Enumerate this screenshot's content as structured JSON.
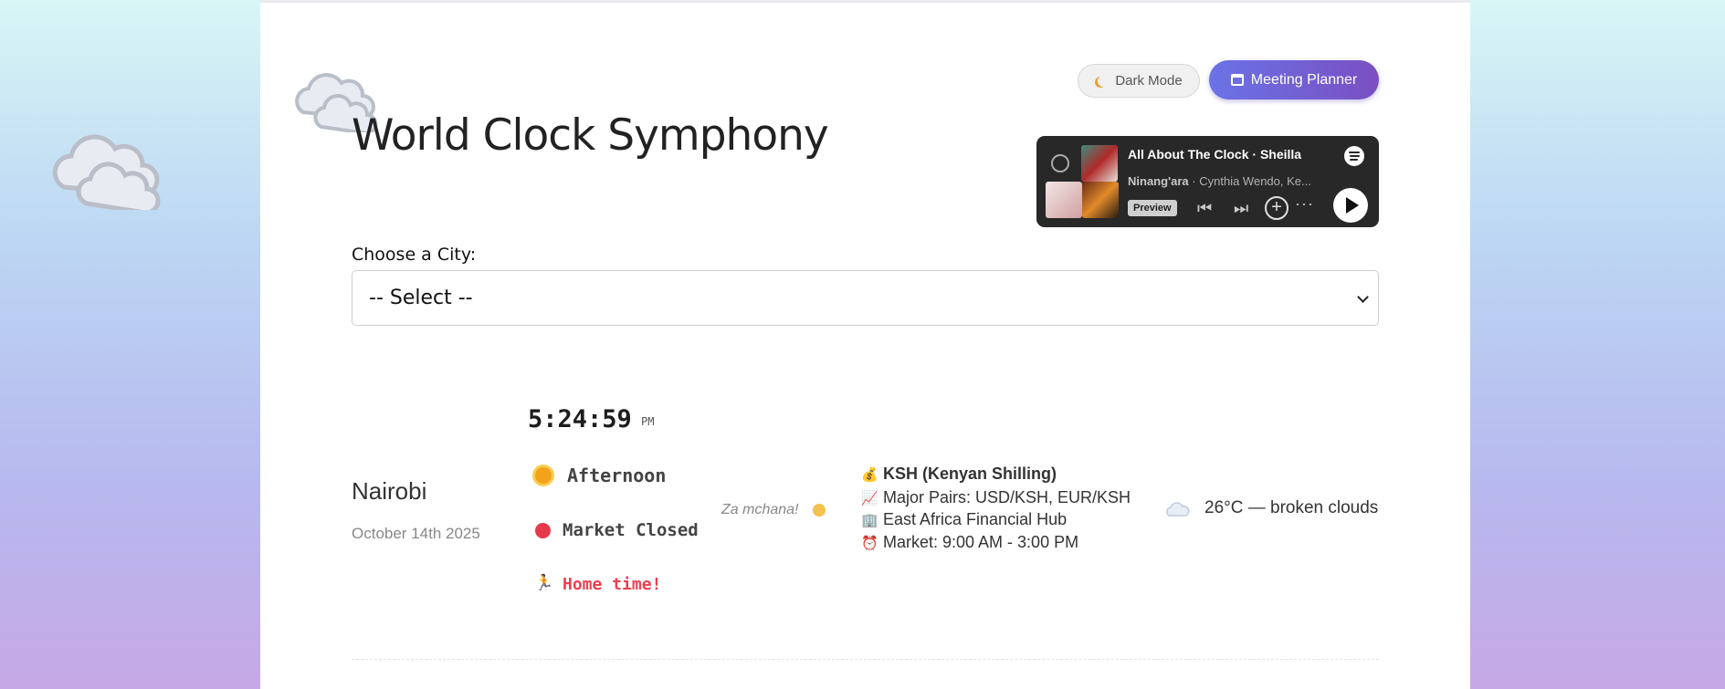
{
  "app": {
    "title": "World Clock Symphony"
  },
  "buttons": {
    "dark_mode": "Dark Mode",
    "meeting_planner": "Meeting Planner"
  },
  "player": {
    "track": "All About The Clock",
    "artist": "Sheilla",
    "album": "Ninang'ara",
    "album_artist": "Cynthia Wendo, Ke...",
    "preview_label": "Preview"
  },
  "city_select": {
    "label": "Choose a City:",
    "selected": "-- Select --"
  },
  "city": {
    "name": "Nairobi",
    "date": "October 14th 2025",
    "time": "5:24:59",
    "ampm": "PM",
    "period": "Afternoon",
    "market_status": "Market Closed",
    "status_message": "Home time!",
    "greeting": "Za mchana!",
    "currency": "KSH (Kenyan Shilling)",
    "major_pairs": "Major Pairs: USD/KSH, EUR/KSH",
    "hub": "East Africa Financial Hub",
    "market_hours": "Market: 9:00 AM - 3:00 PM",
    "weather": "26°C — broken clouds"
  },
  "colors": {
    "accent": "#6a73e6",
    "accent_end": "#7a4fc2",
    "alert": "#ec3f4f",
    "market_closed": "#e53a4a"
  },
  "icons": [
    "cloud-icon",
    "moon-icon",
    "calendar-icon",
    "spotify-icon",
    "sun-icon",
    "red-circle-icon",
    "runner-icon",
    "money-bag-icon",
    "chart-icon",
    "building-icon",
    "alarm-clock-icon"
  ]
}
